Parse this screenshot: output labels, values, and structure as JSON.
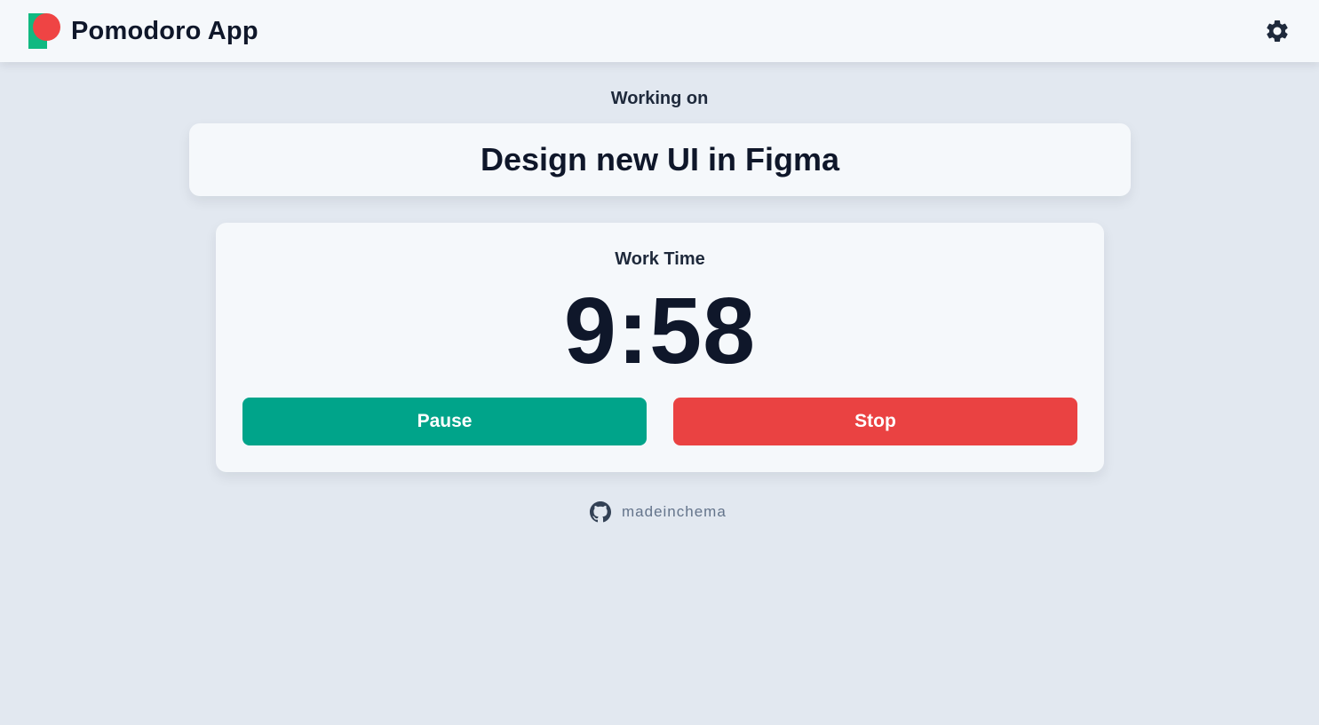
{
  "header": {
    "app_title": "Pomodoro App",
    "logo_icon": "pomodoro-logo",
    "settings_icon": "gear-icon"
  },
  "task": {
    "label": "Working on",
    "title": "Design new UI in Figma"
  },
  "timer": {
    "mode": "Work Time",
    "display": "9:58",
    "pause_label": "Pause",
    "stop_label": "Stop"
  },
  "footer": {
    "github_icon": "github-icon",
    "username": "madeinchema"
  },
  "colors": {
    "background": "#e2e8f0",
    "card": "#f5f8fb",
    "text": "#0f172a",
    "pause": "#00a48a",
    "stop": "#ea4242",
    "logo_green": "#10b981",
    "logo_red": "#ef4444"
  }
}
